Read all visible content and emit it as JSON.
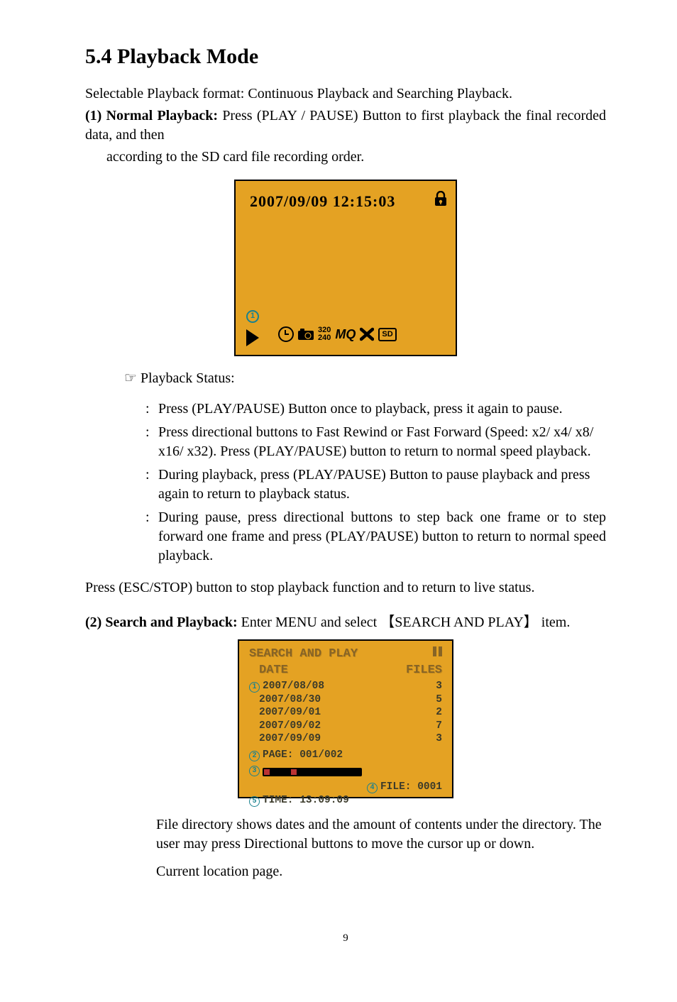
{
  "heading": "5.4 Playback Mode",
  "intro": "Selectable Playback format: Continuous Playback and Searching Playback.",
  "section1": {
    "label": "(1) Normal Playback:",
    "lead": "Press",
    "button": "(PLAY / PAUSE)",
    "tail1": "Button to first playback the final recorded data, and then",
    "tail2": "according to the SD card file recording order."
  },
  "screen1": {
    "timestamp": "2007/09/09 12:15:03",
    "badge": "1",
    "res_top": "320",
    "res_bot": "240",
    "mq": "MQ",
    "sd": "SD"
  },
  "status": {
    "header": "Playback Status:",
    "items": [
      "Press (PLAY/PAUSE) Button once to playback, press it again to pause.",
      "Press directional buttons to Fast Rewind or Fast Forward (Speed: x2/ x4/ x8/ x16/ x32). Press (PLAY/PAUSE) button to return to normal speed playback.",
      "During playback, press (PLAY/PAUSE) Button to pause playback and press again to return to playback status.",
      "During pause, press directional buttons to step back one frame or to step forward one frame and press (PLAY/PAUSE) button to return to normal speed playback."
    ]
  },
  "stop_line": "Press (ESC/STOP) button to stop playback function and to return to live status.",
  "section2": {
    "label": "(2) Search and Playback:",
    "lead": "Enter MENU and select",
    "bracket": "【SEARCH AND PLAY】",
    "tail": "item."
  },
  "screen2": {
    "title": "SEARCH AND PLAY",
    "col1": "DATE",
    "col2": "FILES",
    "rows": [
      {
        "date": "2007/08/08",
        "files": "3"
      },
      {
        "date": "2007/08/30",
        "files": "5"
      },
      {
        "date": "2007/09/01",
        "files": "2"
      },
      {
        "date": "2007/09/02",
        "files": "7"
      },
      {
        "date": "2007/09/09",
        "files": "3"
      }
    ],
    "page_label": "PAGE:",
    "page_val": "001/002",
    "file_label": "FILE:",
    "file_val": "0001",
    "time_label": "TIME:",
    "time_val": "13:09:09",
    "b1": "1",
    "b2": "2",
    "b3": "3",
    "b4": "4",
    "b5": "5"
  },
  "footer": {
    "line1": "File directory shows dates and the amount of contents under the directory. The user may press Directional buttons to move the cursor up or down.",
    "line2": "Current location page."
  },
  "page_number": "9"
}
